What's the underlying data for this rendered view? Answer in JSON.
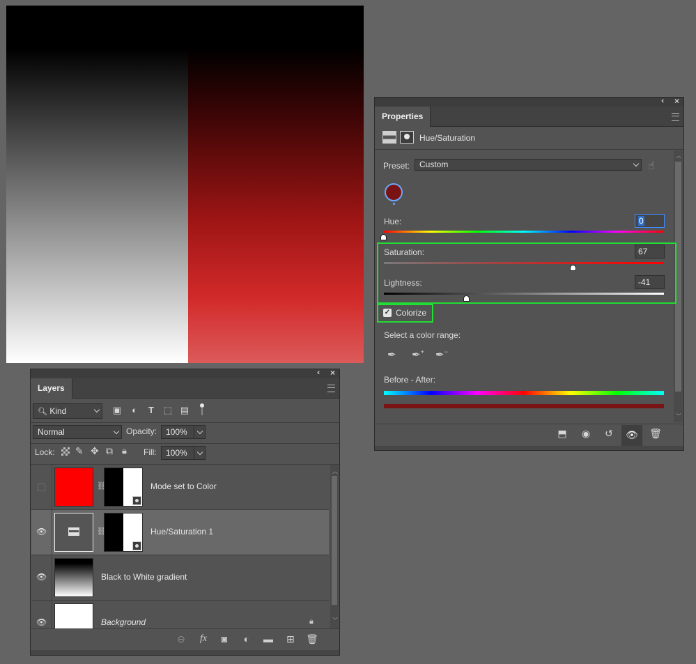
{
  "layers_panel": {
    "tab": "Layers",
    "filter_kind": "Kind",
    "blend_mode": "Normal",
    "opacity_label": "Opacity:",
    "opacity_value": "100%",
    "lock_label": "Lock:",
    "fill_label": "Fill:",
    "fill_value": "100%",
    "layers": [
      {
        "name": "Mode set to Color",
        "visible": false,
        "thumb_color": "#ff0000"
      },
      {
        "name": "Hue/Saturation 1",
        "visible": true,
        "selected": true
      },
      {
        "name": "Black to White gradient",
        "visible": true
      },
      {
        "name": "Background",
        "visible": true,
        "locked": true
      }
    ]
  },
  "properties_panel": {
    "tab": "Properties",
    "adjustment_title": "Hue/Saturation",
    "preset_label": "Preset:",
    "preset_value": "Custom",
    "hue_label": "Hue:",
    "hue_value": "0",
    "saturation_label": "Saturation:",
    "saturation_value": "67",
    "lightness_label": "Lightness:",
    "lightness_value": "-41",
    "colorize_label": "Colorize",
    "colorize_checked": true,
    "color_range_label": "Select a color range:",
    "before_after_label": "Before - After:",
    "swatch_color": "#7a1414",
    "highlight_color": "#22dd33"
  }
}
